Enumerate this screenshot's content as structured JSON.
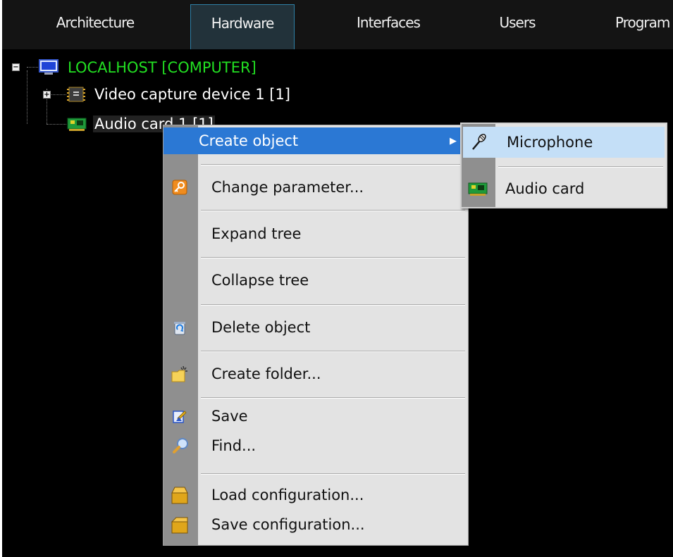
{
  "tabs": [
    {
      "label": "Architecture",
      "active": false
    },
    {
      "label": "Hardware",
      "active": true
    },
    {
      "label": "Interfaces",
      "active": false
    },
    {
      "label": "Users",
      "active": false
    },
    {
      "label": "Program",
      "active": false
    }
  ],
  "tree": {
    "root": {
      "label": "LOCALHOST [COMPUTER]",
      "color": "#22e022",
      "expander": "−"
    },
    "items": [
      {
        "label": "Video capture device 1 [1]",
        "expander": "+"
      },
      {
        "label": "Audio card 1 [1]"
      }
    ]
  },
  "context_menu": {
    "items": [
      {
        "label": "Create object",
        "submenu_arrow": "▶"
      },
      {
        "label": "Change parameter...",
        "icon": "key-icon"
      },
      {
        "label": "Expand tree"
      },
      {
        "label": "Collapse tree"
      },
      {
        "label": "Delete object",
        "icon": "recycle-bin-icon"
      },
      {
        "label": "Create folder...",
        "icon": "new-folder-icon"
      },
      {
        "label": "Save",
        "icon": "save-icon"
      },
      {
        "label": "Find...",
        "icon": "magnifier-icon"
      },
      {
        "label": "Load configuration...",
        "icon": "open-box-icon"
      },
      {
        "label": "Save configuration...",
        "icon": "closed-box-icon"
      }
    ]
  },
  "submenu": {
    "items": [
      {
        "label": "Microphone",
        "icon": "microphone-icon"
      },
      {
        "label": "Audio card",
        "icon": "audio-card-icon"
      }
    ]
  },
  "colors": {
    "highlight": "#2b78d4",
    "submenu_highlight": "#c4dff7",
    "tree_root": "#22e022",
    "tab_active_border": "#2e7fa6"
  }
}
